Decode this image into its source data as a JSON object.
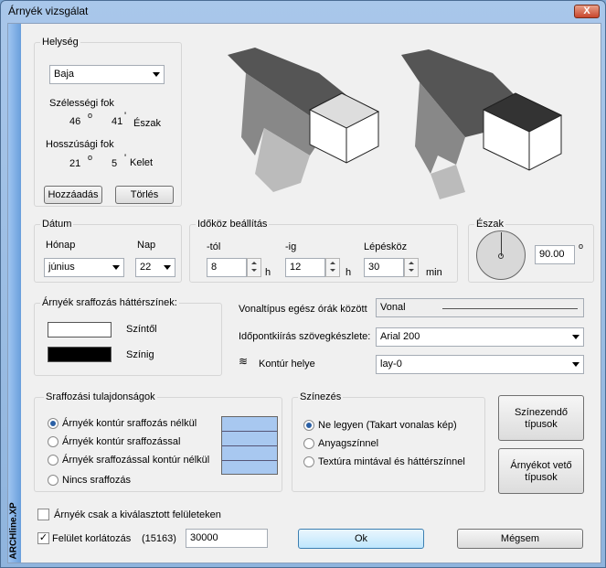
{
  "window": {
    "title": "Árnyék vizsgálat",
    "close_label": "X"
  },
  "sidebar_label": "ARCHline.XP",
  "helyseg": {
    "title": "Helység",
    "city": "Baja",
    "lat_label": "Szélességi fok",
    "lat_deg": "46",
    "lat_min": "41",
    "lat_dir": "Észak",
    "lon_label": "Hosszúsági fok",
    "lon_deg": "21",
    "lon_min": "5",
    "lon_dir": "Kelet",
    "add_button": "Hozzáadás",
    "delete_button": "Törlés"
  },
  "datum": {
    "title": "Dátum",
    "month_label": "Hónap",
    "month": "június",
    "day_label": "Nap",
    "day": "22"
  },
  "idokoz": {
    "title": "Időköz beállítás",
    "from_label": "-tól",
    "from": "8",
    "from_unit": "h",
    "to_label": "-ig",
    "to": "12",
    "to_unit": "h",
    "step_label": "Lépésköz",
    "step": "30",
    "step_unit": "min"
  },
  "eszak": {
    "title": "Észak",
    "angle": "90.00",
    "unit": "o"
  },
  "hatter": {
    "title": "Árnyék sraffozás háttérszínek:",
    "from_label": "Színtől",
    "to_label": "Színig",
    "from_color": "#ffffff",
    "to_color": "#000000"
  },
  "vonal": {
    "linetype_label": "Vonaltípus egész órák között",
    "linetype": "Vonal",
    "font_label": "Időpontkiírás szövegkészlete:",
    "font": "Arial 200",
    "contour_label": "Kontúr helye",
    "contour": "lay-0"
  },
  "sraff": {
    "title": "Sraffozási tulajdonságok",
    "options": [
      "Árnyék kontúr sraffozás nélkül",
      "Árnyék kontúr sraffozással",
      "Árnyék sraffozással kontúr nélkül",
      "Nincs sraffozás"
    ],
    "selected": 0,
    "swatch_color": "#a8c8f0"
  },
  "szinezes": {
    "title": "Színezés",
    "options": [
      "Ne legyen (Takart vonalas kép)",
      "Anyagszínnel",
      "Textúra mintával és háttérszínnel"
    ],
    "selected": 0
  },
  "buttons": {
    "szinezendo": "Színezendő típusok",
    "arnyekvető": "Árnyékot vető típusok",
    "ok": "Ok",
    "megsem": "Mégsem"
  },
  "bottom": {
    "only_selected_label": "Árnyék csak a kiválasztott felületeken",
    "limit_label": "Felület korlátozás",
    "limit_count": "(15163)",
    "limit_value": "30000"
  }
}
